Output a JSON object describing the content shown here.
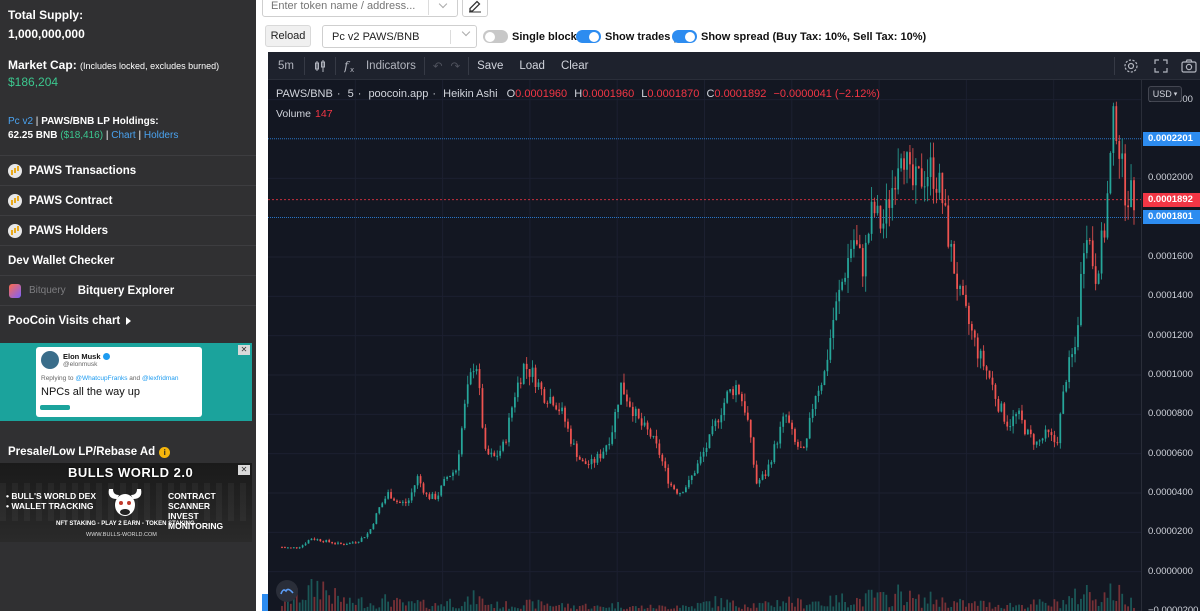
{
  "sidebar": {
    "total_supply_label": "Total Supply:",
    "total_supply_value": "1,000,000,000",
    "market_cap_label": "Market Cap:",
    "market_cap_note": "(Includes locked, excludes burned)",
    "market_cap_value": "$186,204",
    "lp_version": "Pc v2",
    "lp_title": "PAWS/BNB LP Holdings:",
    "lp_bnb": "62.25 BNB",
    "lp_usd": "($18,416)",
    "lp_chart_link": "Chart",
    "lp_holders_link": "Holders",
    "items": [
      {
        "label": "PAWS Transactions",
        "icon": "poocoin-icon"
      },
      {
        "label": "PAWS Contract",
        "icon": "poocoin-icon"
      },
      {
        "label": "PAWS Holders",
        "icon": "poocoin-icon"
      },
      {
        "label": "Dev Wallet Checker",
        "icon": ""
      },
      {
        "label": "Bitquery Explorer",
        "icon": "bitquery-icon",
        "logo_text": "Bitquery"
      },
      {
        "label": "PooCoin Visits chart",
        "icon": "caret-right-icon"
      }
    ],
    "tweet_ad": {
      "name": "Elon Musk",
      "handle": "@elonmusk",
      "reply_prefix": "Replying to",
      "reply_to_1": "@WhatcupFranks",
      "reply_and": "and",
      "reply_to_2": "@lexfridman",
      "body": "NPCs all the way up"
    },
    "presale_label": "Presale/Low LP/Rebase Ad",
    "bulls_ad": {
      "title": "BULLS WORLD 2.0",
      "left_1": "• BULL'S WORLD DEX",
      "left_2": "• WALLET TRACKING",
      "right_1": "CONTRACT SCANNER",
      "right_2": "INVEST MONITORING",
      "sub": "NFT STAKING - PLAY 2 EARN - TOKEN STAKING",
      "url": "WWW.BULLS-WORLD.COM"
    }
  },
  "topbar": {
    "search_placeholder": "Enter token name / address...",
    "reload_label": "Reload",
    "pair_selected": "Pc v2 PAWS/BNB",
    "toggles": [
      {
        "label": "Single blocks",
        "on": false
      },
      {
        "label": "Show trades |",
        "on": true
      },
      {
        "label": "Show spread (Buy Tax: 10%, Sell Tax: 10%)",
        "on": true
      }
    ]
  },
  "chart_toolbar": {
    "interval": "5m",
    "indicators": "Indicators",
    "save": "Save",
    "load": "Load",
    "clear": "Clear"
  },
  "legend": {
    "symbol": "PAWS/BNB",
    "interval": "5",
    "source": "poocoin.app",
    "style": "Heikin Ashi",
    "o": "0.0001960",
    "h": "0.0001960",
    "l": "0.0001870",
    "c": "0.0001892",
    "change": "−0.0000041 (−2.12%)",
    "volume_label": "Volume",
    "volume_value": "147"
  },
  "price_axis": {
    "currency": "USD",
    "ticks": [
      "0.0002400",
      "0.0002000",
      "0.0001600",
      "0.0001400",
      "0.0001200",
      "0.0001000",
      "0.0000800",
      "0.0000600",
      "0.0000400",
      "0.0000200",
      "0.0000000",
      "−0.0000200"
    ],
    "tick_values": [
      0.00024,
      0.0002,
      0.00016,
      0.00014,
      0.00012,
      0.0001,
      8e-05,
      6e-05,
      4e-05,
      2e-05,
      0.0,
      -2e-05
    ],
    "markers": [
      {
        "label": "0.0002201",
        "value": 0.0002201,
        "color": "#2d8cf0"
      },
      {
        "label": "0.0001892",
        "value": 0.0001892,
        "color": "#f23645"
      },
      {
        "label": "0.0001801",
        "value": 0.0001801,
        "color": "#2d8cf0"
      }
    ]
  },
  "colors": {
    "up": "#26a69a",
    "down": "#ef5350",
    "chart_bg": "#131722",
    "accent": "#2d8cf0"
  },
  "chart_data": {
    "type": "candlestick",
    "style": "Heikin Ashi",
    "ylim": [
      -2e-05,
      0.00025
    ],
    "anchors_price": [
      1.25e-05,
      1.2e-05,
      1.3e-05,
      1.7e-05,
      1.6e-05,
      1.5e-05,
      1.4e-05,
      1.45e-05,
      1.6e-05,
      2e-05,
      3.2e-05,
      4e-05,
      3.5e-05,
      3.5e-05,
      4.8e-05,
      3.8e-05,
      3.8e-05,
      4.8e-05,
      5.2e-05,
      8.8e-05,
      0.00011,
      6e-05,
      5.8e-05,
      6.5e-05,
      9e-05,
      0.000105,
      0.0001,
      9e-05,
      8.8e-05,
      8e-05,
      6.5e-05,
      5.5e-05,
      5.5e-05,
      6e-05,
      7e-05,
      9.5e-05,
      8.5e-05,
      7.5e-05,
      7e-05,
      6e-05,
      4.5e-05,
      4e-05,
      4.5e-05,
      5.5e-05,
      6.5e-05,
      7.8e-05,
      9e-05,
      9.5e-05,
      8e-05,
      4.5e-05,
      5e-05,
      6.5e-05,
      8e-05,
      6.5e-05,
      6e-05,
      9e-05,
      0.0001,
      0.00013,
      0.00015,
      0.00017,
      0.000155,
      0.000185,
      0.000175,
      0.000195,
      0.00022,
      0.000195,
      0.0002,
      0.000205,
      0.000195,
      0.000165,
      0.00014,
      0.000125,
      0.00011,
      0.0001,
      8.5e-05,
      7.5e-05,
      8e-05,
      7e-05,
      6.5e-05,
      7e-05,
      6.5e-05,
      0.0001,
      0.000115,
      0.00018,
      0.00015,
      0.000175,
      0.000235,
      0.000195,
      0.0001892
    ],
    "anchors_volume": [
      4e-06,
      6e-06,
      8e-06,
      1e-05,
      1.4e-05,
      8e-06,
      6e-06,
      4e-06,
      5e-06,
      4e-06,
      4e-06,
      6e-06,
      4e-06,
      3e-06,
      4e-06,
      3e-06,
      3e-06,
      5e-06,
      4e-06,
      4e-06,
      7e-06,
      4e-06,
      3e-06,
      3e-06,
      3e-06,
      4e-06,
      3e-06,
      4e-06,
      3e-06,
      3e-06,
      2e-06,
      3e-06,
      2e-06,
      2e-06,
      3e-06,
      3e-06,
      2e-06,
      2e-06,
      2e-06,
      2e-06,
      2e-06,
      3e-06,
      2e-06,
      3e-06,
      4e-06,
      5e-06,
      4e-06,
      3e-06,
      4e-06,
      3e-06,
      3e-06,
      4e-06,
      6e-06,
      4e-06,
      4e-06,
      5e-06,
      4e-06,
      5e-06,
      6e-06,
      6e-06,
      5e-06,
      8e-06,
      6e-06,
      6e-06,
      1e-05,
      6e-06,
      5e-06,
      6e-06,
      5e-06,
      4e-06,
      4e-06,
      3e-06,
      4e-06,
      3e-06,
      3e-06,
      3e-06,
      3e-06,
      3e-06,
      4e-06,
      3e-06,
      4e-06,
      5e-06,
      7e-06,
      1e-05,
      7e-06,
      8e-06,
      1e-05,
      6e-06,
      4e-06
    ]
  }
}
